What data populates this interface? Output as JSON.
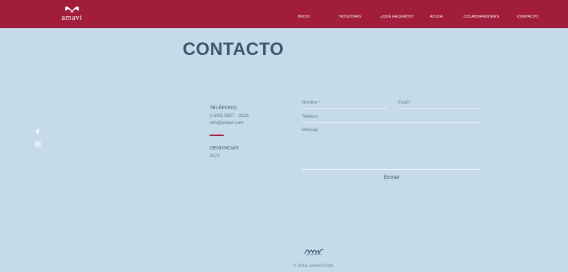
{
  "colors": {
    "header_bg": "#a11d3b",
    "page_bg": "#c6dbe9",
    "title": "#3b556b",
    "accent": "#a11d3b"
  },
  "brand": {
    "name": "amavi"
  },
  "nav": {
    "items": [
      {
        "label": "INICIO"
      },
      {
        "label": "NOSOTRAS"
      },
      {
        "label": "¿QUÉ HACEMOS?"
      },
      {
        "label": "AYUDA"
      },
      {
        "label": "COLABORADORES"
      },
      {
        "label": "CONTACTO"
      }
    ]
  },
  "page": {
    "title": "CONTACTO"
  },
  "social": {
    "icons": [
      "facebook-icon",
      "instagram-icon"
    ]
  },
  "contact_info": {
    "phone_label": "TELÉFONO:",
    "phone": "(+502) 3007 - 3129",
    "email": "info@amavi.com",
    "complaints_label": "DENUNCIAS",
    "complaints_number": "1572"
  },
  "form": {
    "name_label": "Nombre *",
    "email_label": "Email *",
    "phone_label": "Teléfono",
    "message_label": "Mensaje",
    "submit_label": "Enviar"
  },
  "footer": {
    "copyright": "© 2016. AMAVI.COM"
  }
}
